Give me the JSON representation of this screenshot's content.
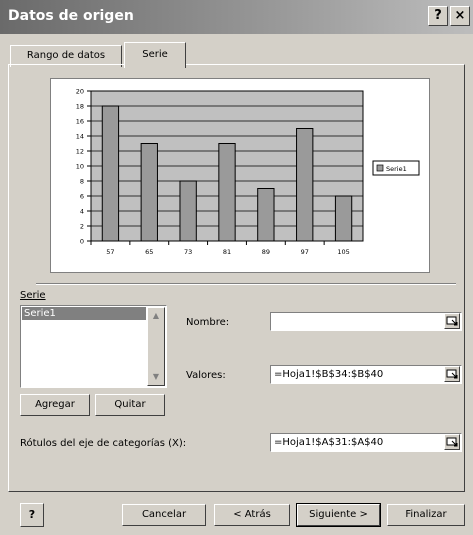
{
  "window": {
    "title": "Datos de origen",
    "help_glyph": "?",
    "close_glyph": "×"
  },
  "tabs": [
    {
      "label": "Rango de datos",
      "active": false
    },
    {
      "label": "Serie",
      "active": true
    }
  ],
  "chart_data": {
    "type": "bar",
    "categories": [
      "57",
      "65",
      "73",
      "81",
      "89",
      "97",
      "105"
    ],
    "series": [
      {
        "name": "Serie1",
        "values": [
          18,
          13,
          8,
          13,
          7,
          15,
          6
        ]
      }
    ],
    "yticks": [
      "0",
      "2",
      "4",
      "6",
      "8",
      "10",
      "12",
      "14",
      "16",
      "18",
      "20"
    ],
    "ylim": [
      0,
      20
    ],
    "grid": true,
    "legend": "right",
    "colors": {
      "bar": "#9a9a9a",
      "plot_bg": "#c0c0c0",
      "bar_border": "#000000"
    }
  },
  "series_section": {
    "label": "Serie",
    "items": [
      "Serie1"
    ],
    "add_button": "Agregar",
    "remove_button": "Quitar"
  },
  "fields": {
    "name_label": "Nombre:",
    "name_value": "",
    "values_label": "Valores:",
    "values_value": "=Hoja1!$B$34:$B$40",
    "category_label": "Rótulos del eje de categorías (X):",
    "category_value": "=Hoja1!$A$31:$A$40"
  },
  "footer": {
    "cancel": "Cancelar",
    "back": "< Atrás",
    "next": "Siguiente >",
    "finish": "Finalizar"
  }
}
